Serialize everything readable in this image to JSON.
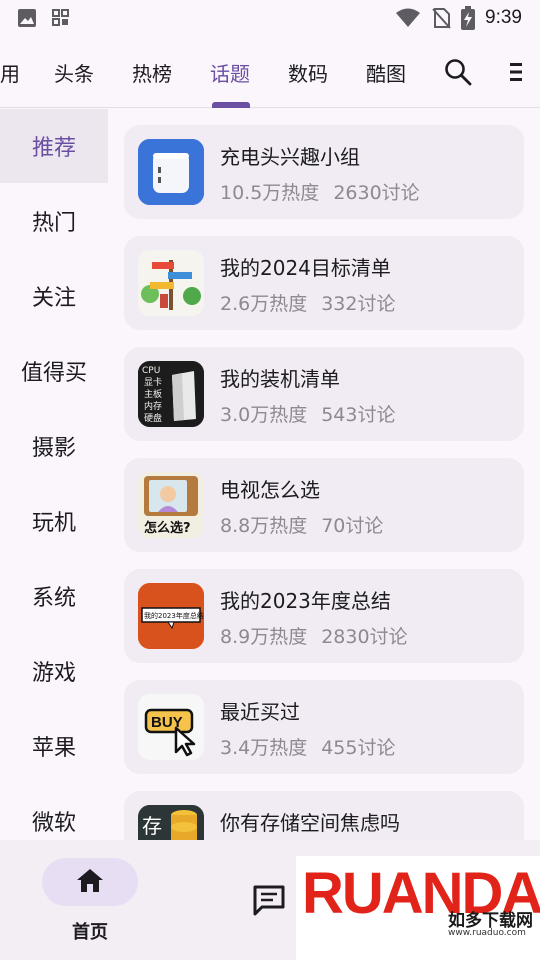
{
  "status_bar": {
    "time": "9:39",
    "left_icons": [
      "image-icon",
      "grid-icon"
    ],
    "right_icons": [
      "wifi-icon",
      "no-sim-icon",
      "battery-charging-icon"
    ]
  },
  "top_tabs": {
    "items": [
      {
        "label": "用"
      },
      {
        "label": "头条"
      },
      {
        "label": "热榜"
      },
      {
        "label": "话题"
      },
      {
        "label": "数码"
      },
      {
        "label": "酷图"
      }
    ],
    "active": "话题",
    "accent_color": "#6a4fa3"
  },
  "sidebar": {
    "items": [
      {
        "label": "推荐"
      },
      {
        "label": "热门"
      },
      {
        "label": "关注"
      },
      {
        "label": "值得买"
      },
      {
        "label": "摄影"
      },
      {
        "label": "玩机"
      },
      {
        "label": "系统"
      },
      {
        "label": "游戏"
      },
      {
        "label": "苹果"
      },
      {
        "label": "微软"
      }
    ],
    "active": "推荐"
  },
  "topics": [
    {
      "title": "充电头兴趣小组",
      "heat": "10.5万热度",
      "discuss": "2630讨论",
      "thumb_icon": "charger-icon"
    },
    {
      "title": "我的2024目标清单",
      "heat": "2.6万热度",
      "discuss": "332讨论",
      "thumb_icon": "signpost-icon"
    },
    {
      "title": "我的装机清单",
      "heat": "3.0万热度",
      "discuss": "543讨论",
      "thumb_icon": "pc-case-icon",
      "thumb_text": [
        "CPU",
        "显卡",
        "主板",
        "内存",
        "硬盘"
      ]
    },
    {
      "title": "电视怎么选",
      "heat": "8.8万热度",
      "discuss": "70讨论",
      "thumb_icon": "tv-icon",
      "thumb_text": [
        "怎么选?"
      ]
    },
    {
      "title": "我的2023年度总结",
      "heat": "8.9万热度",
      "discuss": "2830讨论",
      "thumb_icon": "summary-banner-icon",
      "thumb_text": [
        "我的2023年度总结"
      ]
    },
    {
      "title": "最近买过",
      "heat": "3.4万热度",
      "discuss": "455讨论",
      "thumb_icon": "buy-cursor-icon",
      "thumb_text": [
        "BUY"
      ]
    },
    {
      "title": "你有存储空间焦虑吗",
      "heat": "",
      "discuss": "",
      "thumb_icon": "storage-icon",
      "thumb_text": [
        "存"
      ]
    }
  ],
  "bottom_nav": {
    "items": [
      {
        "label": "首页",
        "icon": "home-icon",
        "active": true
      },
      {
        "label": "",
        "icon": "message-icon",
        "active": false
      }
    ]
  },
  "watermark": {
    "word": "RUANDAO",
    "subtitle": "如多下载网",
    "url": "www.ruaduo.com"
  }
}
